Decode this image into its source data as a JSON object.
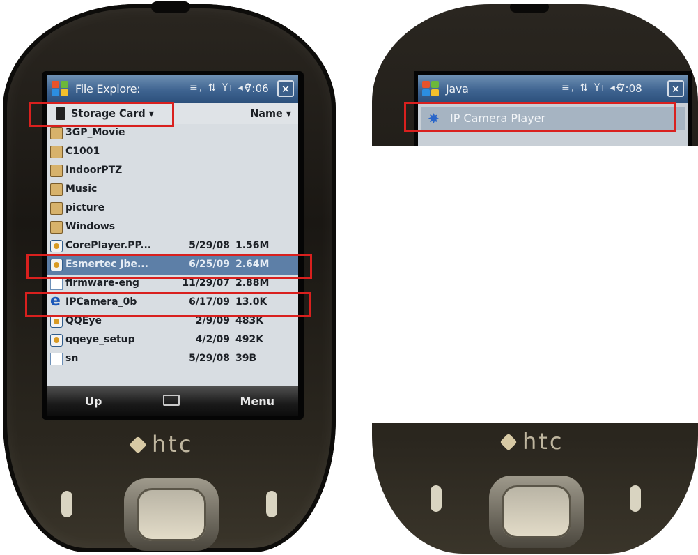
{
  "left_device": {
    "brand": "htc",
    "title_bar": {
      "app_title": "File Explore:",
      "status_icons": "≡, ⇅ Yı ◂€",
      "time": "7:06",
      "close_label": "✕"
    },
    "path_bar": {
      "location": "Storage Card ▾",
      "sort_by": "Name ▾"
    },
    "files": [
      {
        "name": "3GP_Movie",
        "date": "",
        "size": "",
        "icon": "folder-icon"
      },
      {
        "name": "C1001",
        "date": "",
        "size": "",
        "icon": "folder-icon"
      },
      {
        "name": "IndoorPTZ",
        "date": "",
        "size": "",
        "icon": "folder-icon"
      },
      {
        "name": "Music",
        "date": "",
        "size": "",
        "icon": "folder-icon"
      },
      {
        "name": "picture",
        "date": "",
        "size": "",
        "icon": "folder-icon"
      },
      {
        "name": "Windows",
        "date": "",
        "size": "",
        "icon": "folder-icon"
      },
      {
        "name": "CorePlayer.PP...",
        "date": "5/29/08",
        "size": "1.56M",
        "icon": "installer-icon"
      },
      {
        "name": "Esmertec Jbe...",
        "date": "6/25/09",
        "size": "2.64M",
        "icon": "installer-icon",
        "selected": true
      },
      {
        "name": "firmware-eng",
        "date": "11/29/07",
        "size": "2.88M",
        "icon": "file-icon"
      },
      {
        "name": "IPCamera_0b",
        "date": "6/17/09",
        "size": "13.0K",
        "icon": "ie-icon"
      },
      {
        "name": "QQEye",
        "date": "2/9/09",
        "size": "483K",
        "icon": "installer-icon"
      },
      {
        "name": "qqeye_setup",
        "date": "4/2/09",
        "size": "492K",
        "icon": "installer-icon"
      },
      {
        "name": "sn",
        "date": "5/29/08",
        "size": "39B",
        "icon": "file-icon"
      }
    ],
    "softkeys": {
      "left": "Up",
      "center_icon": "keyboard-icon",
      "right": "Menu"
    }
  },
  "right_device": {
    "brand": "htc",
    "title_bar": {
      "app_title": "Java",
      "status_icons": "≡, ⇅ Yı ◂€",
      "time": "7:08",
      "close_label": "✕"
    },
    "list_item": {
      "label": "IP Camera Player",
      "icon": "java-star-icon"
    }
  },
  "colors": {
    "highlight": "#d9201e",
    "titlebar": "#3e6390",
    "selection": "#5d7fa7",
    "screen_bg": "#d8dde2"
  }
}
